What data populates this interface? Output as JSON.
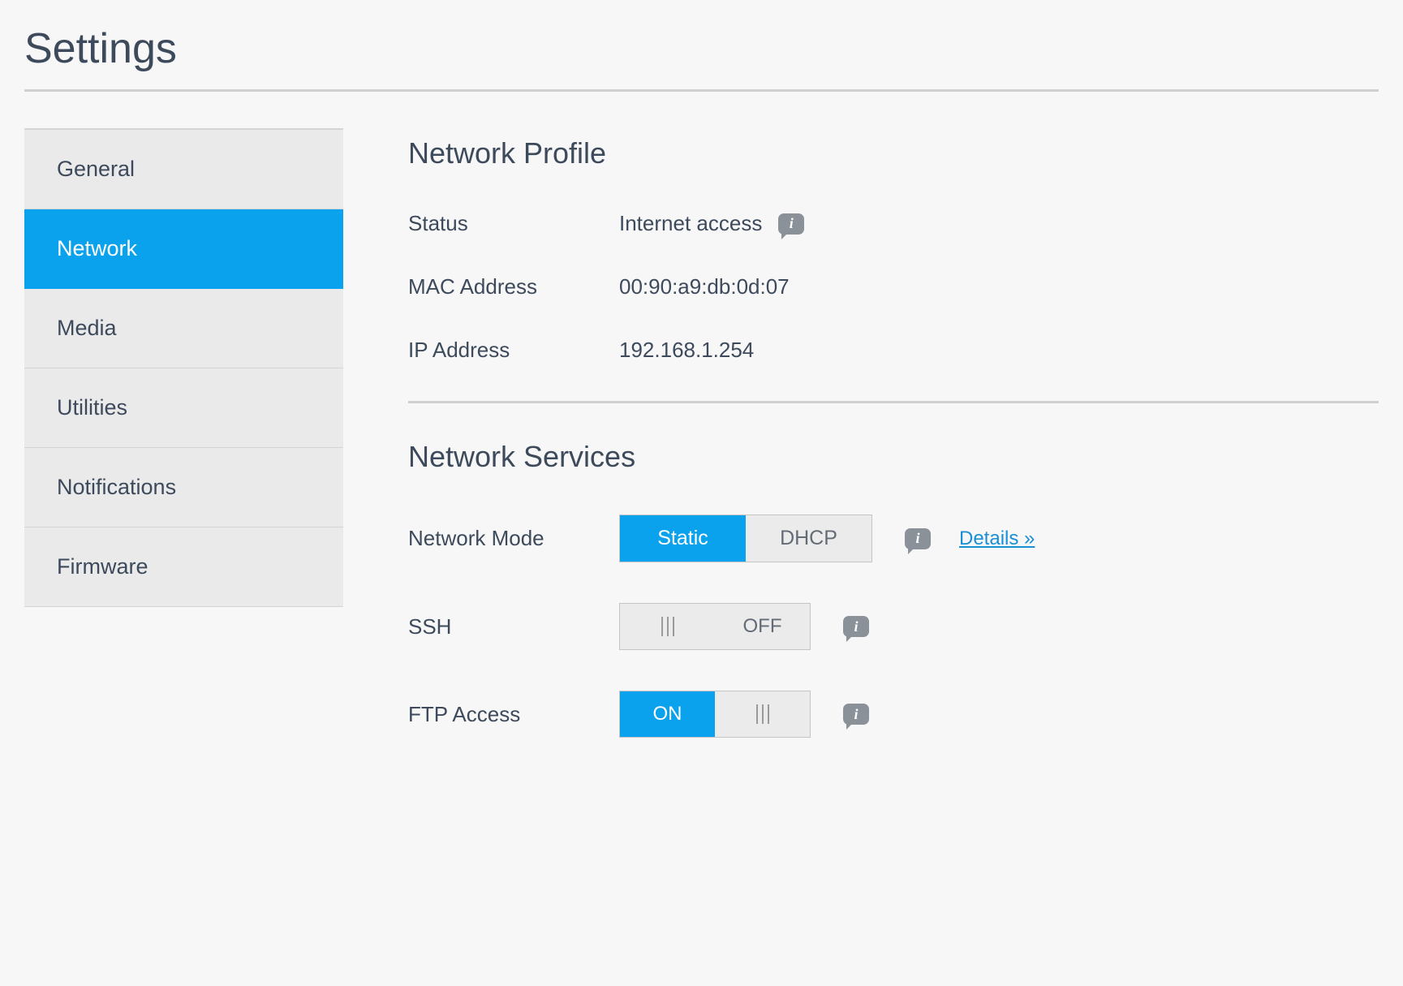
{
  "page": {
    "title": "Settings"
  },
  "sidebar": {
    "items": [
      {
        "label": "General",
        "active": false
      },
      {
        "label": "Network",
        "active": true
      },
      {
        "label": "Media",
        "active": false
      },
      {
        "label": "Utilities",
        "active": false
      },
      {
        "label": "Notifications",
        "active": false
      },
      {
        "label": "Firmware",
        "active": false
      }
    ]
  },
  "network_profile": {
    "title": "Network Profile",
    "status_label": "Status",
    "status_value": "Internet access",
    "mac_label": "MAC Address",
    "mac_value": "00:90:a9:db:0d:07",
    "ip_label": "IP Address",
    "ip_value": "192.168.1.254"
  },
  "network_services": {
    "title": "Network Services",
    "mode_label": "Network Mode",
    "mode_static": "Static",
    "mode_dhcp": "DHCP",
    "mode_details": "Details »",
    "ssh_label": "SSH",
    "ssh_off": "OFF",
    "ftp_label": "FTP Access",
    "ftp_on": "ON"
  }
}
